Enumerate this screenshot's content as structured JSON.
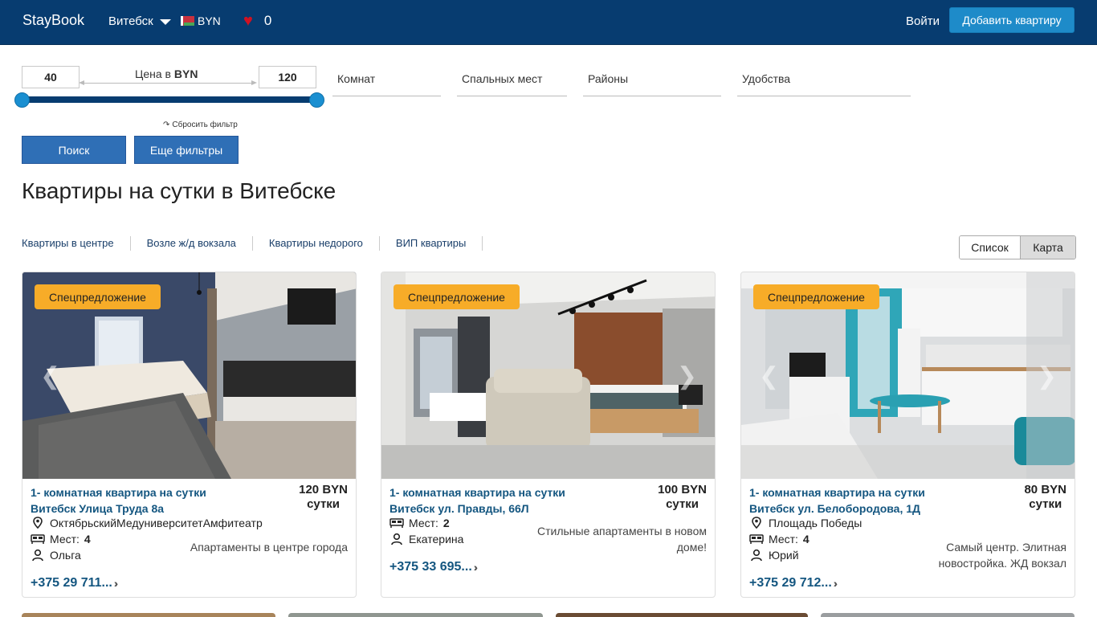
{
  "nav": {
    "brand": "StayBook",
    "city": "Витебск",
    "currency": "BYN",
    "favorites_count": "0",
    "login": "Войти",
    "add_listing": "Добавить квартиру"
  },
  "filters": {
    "price_min": "40",
    "price_max": "120",
    "price_label_prefix": "Цена в",
    "price_currency": "BYN",
    "reset": "Сбросить фильтр",
    "rooms": "Комнат",
    "beds": "Спальных мест",
    "districts": "Районы",
    "amenities": "Удобства",
    "search": "Поиск",
    "more_filters": "Еще фильтры"
  },
  "page_title": "Квартиры на сутки в Витебске",
  "quick_links": [
    "Квартиры в центре",
    "Возле ж/д вокзала",
    "Квартиры недорого",
    "ВИП квартиры"
  ],
  "view_toggle": {
    "list": "Список",
    "map": "Карта"
  },
  "colors": {
    "nav_bg": "#073c70",
    "accent": "#1e8bc9",
    "badge": "#f7ac28",
    "title_link": "#145680"
  },
  "listings": [
    {
      "badge": "Спецпредложение",
      "title_line1": "1- комнатная квартира на сутки",
      "title_line2": "Витебск Улица Труда 8а",
      "price": "120 BYN",
      "price_unit": "сутки",
      "location": "ОктябрьскийМедуниверситетАмфитеатр",
      "places_label": "Мест:",
      "places": "4",
      "host": "Ольга",
      "description": "Апартаменты в центре города",
      "phone": "+375 29 711..."
    },
    {
      "badge": "Спецпредложение",
      "title_line1": "1- комнатная квартира на сутки",
      "title_line2": "Витебск ул. Правды, 66Л",
      "price": "100 BYN",
      "price_unit": "сутки",
      "places_label": "Мест:",
      "places": "2",
      "host": "Екатерина",
      "description_line1": "Стильные апартаменты в новом",
      "description_line2": "доме!",
      "phone": "+375 33 695..."
    },
    {
      "badge": "Спецпредложение",
      "title_line1": "1- комнатная квартира на сутки",
      "title_line2": "Витебск ул. Белобородова, 1Д",
      "price": "80 BYN",
      "price_unit": "сутки",
      "location": "Площадь Победы",
      "places_label": "Мест:",
      "places": "4",
      "host": "Юрий",
      "description_line1": "Самый центр. Элитная",
      "description_line2": "новостройка. ЖД вокзал",
      "phone": "+375 29 712..."
    }
  ]
}
